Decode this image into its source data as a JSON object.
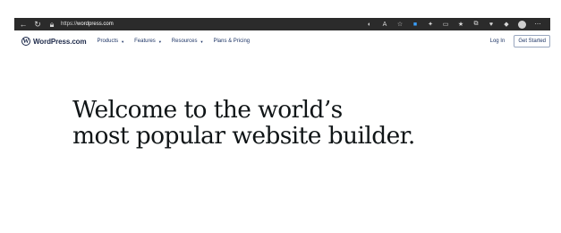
{
  "browser": {
    "url_scheme": "https://",
    "url_host": "wordpress.com",
    "icons": [
      "back-arrow-icon",
      "refresh-icon",
      "lock-icon",
      "tracking-icon",
      "read-aloud-icon",
      "favorite-star-icon",
      "extension-icon",
      "puzzle-icon",
      "split-screen-icon",
      "favorites-icon",
      "collections-icon",
      "performance-icon",
      "copilot-icon",
      "profile-avatar",
      "more-menu-icon"
    ]
  },
  "site": {
    "logo_text": "WordPress.com",
    "menu": [
      {
        "label": "Products",
        "has_dropdown": true
      },
      {
        "label": "Features",
        "has_dropdown": true
      },
      {
        "label": "Resources",
        "has_dropdown": true
      },
      {
        "label": "Plans & Pricing",
        "has_dropdown": false
      }
    ],
    "login_label": "Log In",
    "get_started_label": "Get Started"
  },
  "hero": {
    "line1": "Welcome to the world’s",
    "line2": "most popular website builder."
  }
}
